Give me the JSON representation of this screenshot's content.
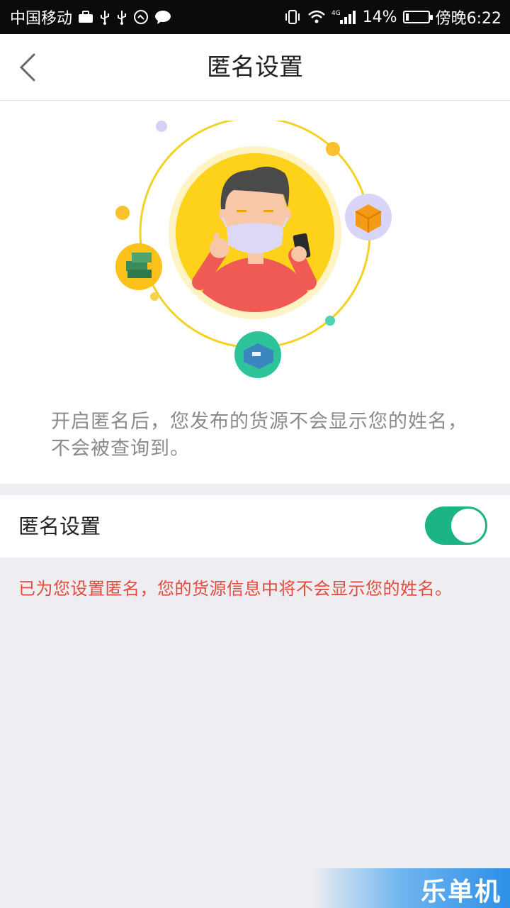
{
  "status_bar": {
    "carrier": "中国移动",
    "network": "4G",
    "battery_percent": "14%",
    "battery_level": 0.14,
    "time": "傍晚6:22",
    "left_icons": [
      "briefcase-icon",
      "usb-icon",
      "usb-icon",
      "sync-icon",
      "chat-icon"
    ],
    "right_icons": [
      "vibrate-icon",
      "wifi-icon",
      "signal-icon",
      "battery-icon"
    ]
  },
  "nav": {
    "title": "匿名设置",
    "back_icon": "chevron-left-icon"
  },
  "hero": {
    "illustration": "masked-person-illustration",
    "description": "开启匿名后，您发布的货源不会显示您的姓名，不会被查询到。"
  },
  "setting": {
    "label": "匿名设置",
    "enabled": true,
    "toggle_color": "#1cb484"
  },
  "hint": {
    "text": "已为您设置匿名，您的货源信息中将不会显示您的姓名。",
    "color": "#e24a3b"
  },
  "watermark": {
    "text": "乐单机"
  }
}
